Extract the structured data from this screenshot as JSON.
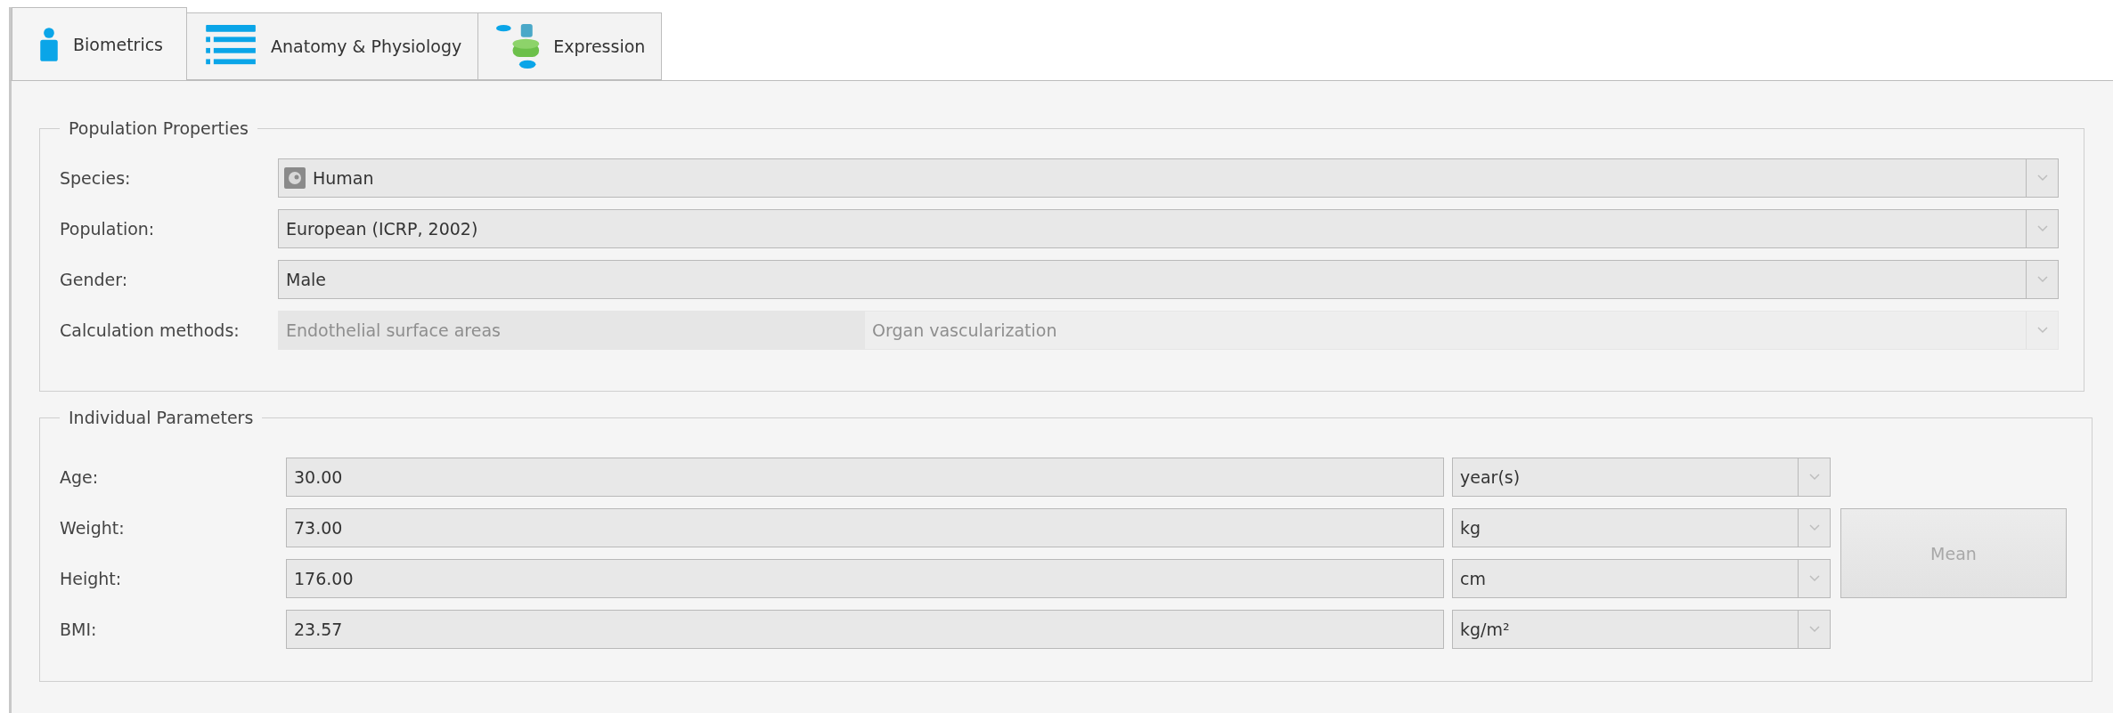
{
  "tabs": [
    {
      "label": "Biometrics",
      "selected": true,
      "kind": "person"
    },
    {
      "label": "Anatomy & Physiology",
      "selected": false,
      "kind": "list"
    },
    {
      "label": "Expression",
      "selected": false,
      "kind": "database"
    }
  ],
  "population_properties": {
    "title": "Population Properties",
    "rows": [
      {
        "kind": "icon-dropdown",
        "label": "Species:",
        "value": "Human",
        "disabled": false
      },
      {
        "kind": "dropdown",
        "label": "Population:",
        "value": "European (ICRP, 2002)",
        "disabled": false
      },
      {
        "kind": "dropdown",
        "label": "Gender:",
        "value": "Male",
        "disabled": false
      },
      {
        "kind": "split",
        "label": "Calculation methods:",
        "values": [
          "Endothelial surface areas",
          "Organ vascularization"
        ],
        "disabled": true
      }
    ]
  },
  "individual_parameters": {
    "title": "Individual Parameters",
    "rows": [
      {
        "label": "Age:",
        "value": "30.00",
        "unit": "year(s)"
      },
      {
        "label": "Weight:",
        "value": "73.00",
        "unit": "kg"
      },
      {
        "label": "Height:",
        "value": "176.00",
        "unit": "cm"
      },
      {
        "label": "BMI:",
        "value": "23.57",
        "unit": "kg/m²"
      }
    ],
    "button": {
      "label": "Mean",
      "disabled": true
    }
  }
}
